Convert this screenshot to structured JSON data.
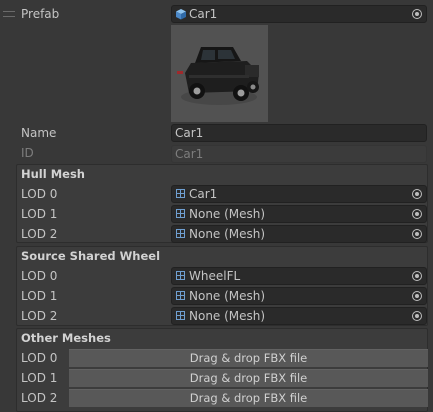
{
  "prefab": {
    "label": "Prefab",
    "value": "Car1"
  },
  "name": {
    "label": "Name",
    "value": "Car1"
  },
  "id": {
    "label": "ID",
    "value": "Car1"
  },
  "hull_mesh": {
    "title": "Hull Mesh",
    "rows": [
      {
        "label": "LOD 0",
        "value": "Car1"
      },
      {
        "label": "LOD 1",
        "value": "None (Mesh)"
      },
      {
        "label": "LOD 2",
        "value": "None (Mesh)"
      }
    ]
  },
  "source_shared_wheel": {
    "title": "Source Shared Wheel",
    "rows": [
      {
        "label": "LOD 0",
        "value": "WheelFL"
      },
      {
        "label": "LOD 1",
        "value": "None (Mesh)"
      },
      {
        "label": "LOD 2",
        "value": "None (Mesh)"
      }
    ]
  },
  "other_meshes": {
    "title": "Other Meshes",
    "rows": [
      {
        "label": "LOD 0",
        "button": "Drag & drop FBX file"
      },
      {
        "label": "LOD 1",
        "button": "Drag & drop FBX file"
      },
      {
        "label": "LOD 2",
        "button": "Drag & drop FBX file"
      }
    ]
  },
  "colors": {
    "background": "#383838",
    "field": "#2a2a2a",
    "accent_icon": "#6f9fd1"
  },
  "icons": [
    "drag-handle-icon",
    "prefab-cube-icon",
    "object-picker-icon",
    "mesh-icon"
  ]
}
